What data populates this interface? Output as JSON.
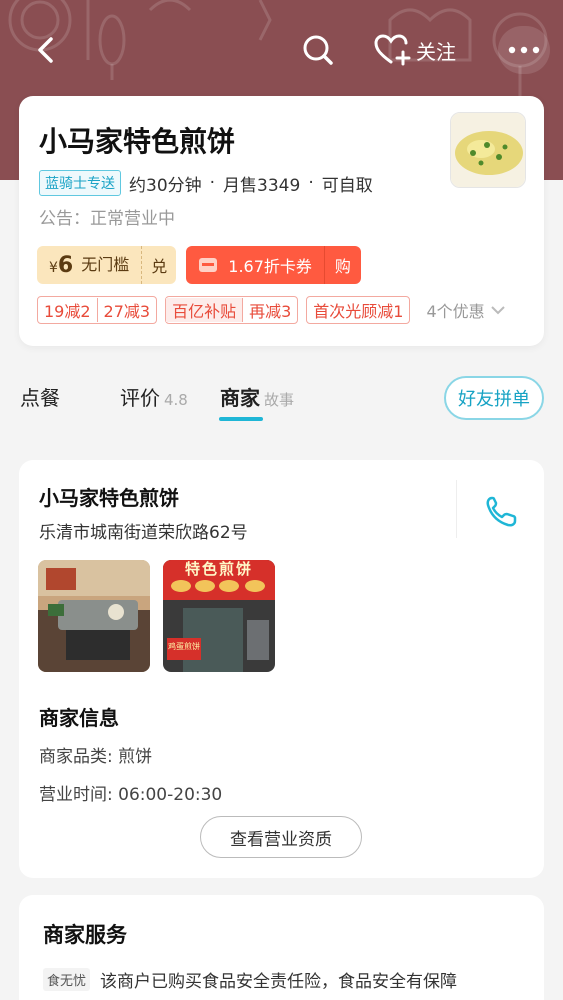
{
  "header": {
    "follow_label": "关注",
    "icons": [
      "back-arrow-icon",
      "search-icon",
      "heart-plus-icon",
      "more-dots-icon"
    ]
  },
  "shop": {
    "name": "小马家特色煎饼",
    "delivery_tag": "蓝骑士专送",
    "delivery_time": "约30分钟",
    "monthly_sales": "月售3349",
    "pickup": "可自取",
    "notice": "公告：正常营业中"
  },
  "coupons": {
    "voucher_currency": "¥",
    "voucher_amount": "6",
    "voucher_desc": "无门槛",
    "voucher_action": "兑",
    "card_label": "1.67折卡券",
    "card_action": "购"
  },
  "promos": {
    "tag1": [
      "19减2",
      "27减3"
    ],
    "tag2": [
      "百亿补贴",
      "再减3"
    ],
    "tag3": "首次光顾减1",
    "more": "4个优惠"
  },
  "tabs": {
    "order": "点餐",
    "reviews": "评价",
    "reviews_score": "4.8",
    "merchant": "商家",
    "merchant_sub": "故事",
    "group_order": "好友拼单"
  },
  "merchant": {
    "name": "小马家特色煎饼",
    "address": "乐清市城南街道荣欣路62号",
    "info_title": "商家信息",
    "category": "商家品类: 煎饼",
    "hours": "营业时间: 06:00-20:30",
    "license_button": "查看营业资质",
    "storefront_sign": "特色煎饼",
    "storefront_banner": "鸡蛋煎饼"
  },
  "service": {
    "title": "商家服务",
    "badge": "食无忧",
    "text": "该商户已购买食品安全责任险，食品安全有保障"
  },
  "colors": {
    "hero_bg": "#8a4e52",
    "accent_blue": "#1fb6d6",
    "coupon_red": "#ff5a40",
    "coupon_gold": "#fbe6bd",
    "promo_red": "#e84b3a"
  }
}
